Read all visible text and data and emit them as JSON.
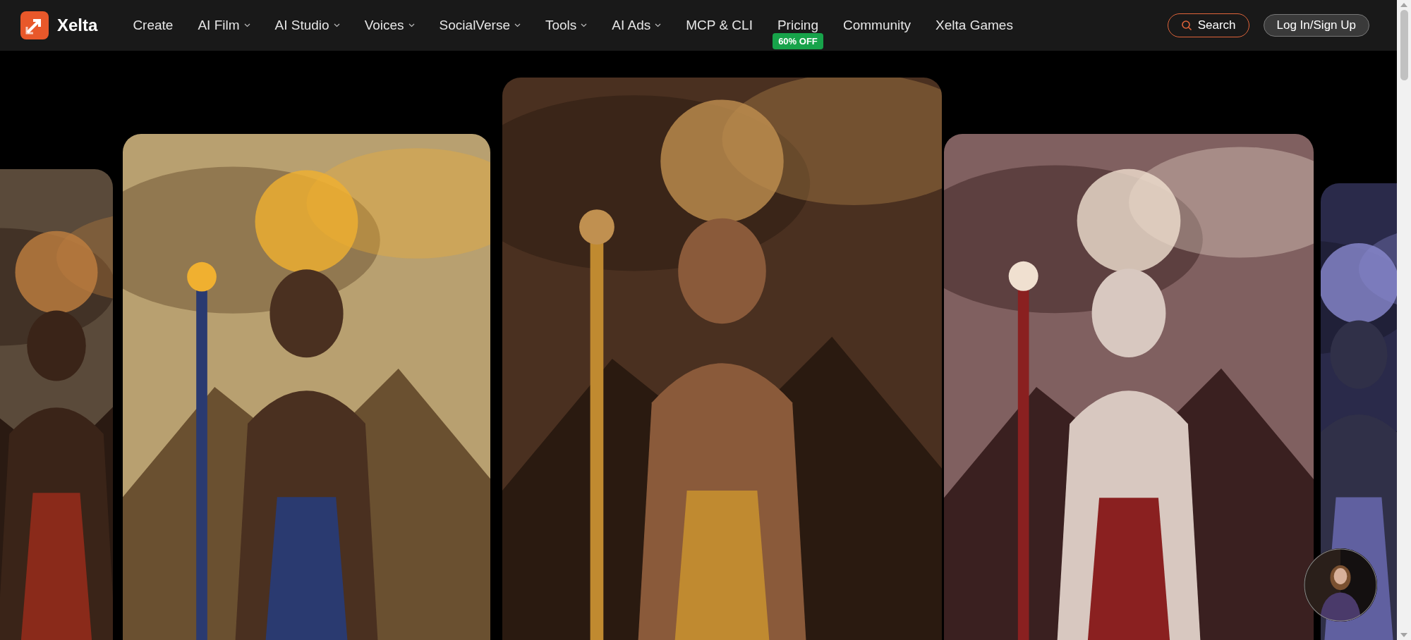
{
  "brand": {
    "name": "Xelta"
  },
  "nav": [
    {
      "label": "Create",
      "has_menu": false
    },
    {
      "label": "AI Film",
      "has_menu": true
    },
    {
      "label": "AI Studio",
      "has_menu": true
    },
    {
      "label": "Voices",
      "has_menu": true
    },
    {
      "label": "SocialVerse",
      "has_menu": true
    },
    {
      "label": "Tools",
      "has_menu": true
    },
    {
      "label": "AI Ads",
      "has_menu": true
    },
    {
      "label": "MCP & CLI",
      "has_menu": false
    },
    {
      "label": "Pricing",
      "has_menu": false,
      "badge": "60% OFF"
    },
    {
      "label": "Community",
      "has_menu": false
    },
    {
      "label": "Xelta Games",
      "has_menu": false
    }
  ],
  "search_button": {
    "label": "Search"
  },
  "login_button": {
    "label": "Log In/Sign Up"
  }
}
